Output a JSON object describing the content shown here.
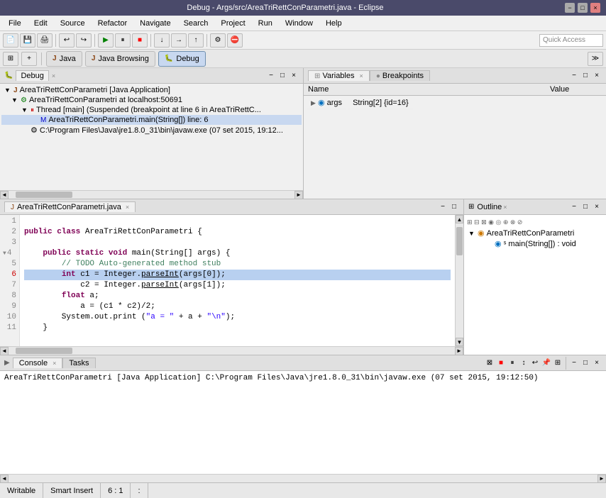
{
  "titleBar": {
    "text": "Debug - Args/src/AreaTriRettConParametri.java - Eclipse",
    "controls": [
      "−",
      "□",
      "×"
    ]
  },
  "menuBar": {
    "items": [
      "File",
      "Edit",
      "Source",
      "Refactor",
      "Navigate",
      "Search",
      "Project",
      "Run",
      "Window",
      "Help"
    ]
  },
  "toolbar2": {
    "perspectives": [
      "Java",
      "Java Browsing",
      "Debug"
    ],
    "quickAccess": "Quick Access"
  },
  "debugPanel": {
    "title": "Debug",
    "closeLabel": "×",
    "treeItems": [
      {
        "indent": 0,
        "label": "AreaTriRettConParametri [Java Application]",
        "icon": "J"
      },
      {
        "indent": 1,
        "label": "AreaTriRettConParametri at localhost:50691",
        "icon": "C"
      },
      {
        "indent": 2,
        "label": "Thread [main] (Suspended (breakpoint at line 6 in AreaTriRettC...",
        "icon": "T"
      },
      {
        "indent": 3,
        "label": "AreaTriRettConParametri.main(String[]) line: 6",
        "icon": "M"
      },
      {
        "indent": 2,
        "label": "C:\\Program Files\\Java\\jre1.8.0_31\\bin\\javaw.exe (07 set 2015, 19:12...",
        "icon": "C"
      }
    ]
  },
  "variablesPanel": {
    "tabs": [
      "Variables",
      "Breakpoints"
    ],
    "activeTab": "Variables",
    "columns": [
      "Name",
      "Value"
    ],
    "rows": [
      {
        "name": "args",
        "value": "String[2]  {id=16}",
        "arrow": true
      }
    ]
  },
  "editorPanel": {
    "filename": "AreaTriRettConParametri.java",
    "lines": [
      {
        "num": 1,
        "code": "",
        "type": "normal"
      },
      {
        "num": 2,
        "code": "public class AreaTriRettConParametri {",
        "type": "normal"
      },
      {
        "num": 3,
        "code": "",
        "type": "normal"
      },
      {
        "num": 4,
        "code": "    public static void main(String[] args) {",
        "type": "normal"
      },
      {
        "num": 5,
        "code": "        // TODO Auto-generated method stub",
        "type": "comment"
      },
      {
        "num": 6,
        "code": "        int c1 = Integer.parseInt(args[0]);",
        "type": "highlighted"
      },
      {
        "num": 7,
        "code": "            c2 = Integer.parseInt(args[1]);",
        "type": "normal"
      },
      {
        "num": 8,
        "code": "        float a;",
        "type": "normal"
      },
      {
        "num": 9,
        "code": "            a = (c1 * c2)/2;",
        "type": "normal"
      },
      {
        "num": 10,
        "code": "        System.out.print (\"a = \" + a + \"\\n\");",
        "type": "normal"
      },
      {
        "num": 11,
        "code": "    }",
        "type": "normal"
      }
    ]
  },
  "outlinePanel": {
    "title": "Outline",
    "items": [
      {
        "label": "AreaTriRettConParametri",
        "icon": "C",
        "indent": 0
      },
      {
        "label": "main(String[]) : void",
        "icon": "M",
        "indent": 1
      }
    ]
  },
  "consolePanel": {
    "title": "Console",
    "tabs": [
      "Console",
      "Tasks"
    ],
    "activeTab": "Console",
    "content": "AreaTriRettConParametri [Java Application] C:\\Program Files\\Java\\jre1.8.0_31\\bin\\javaw.exe (07 set 2015, 19:12:50)"
  },
  "statusBar": {
    "writable": "Writable",
    "insertMode": "Smart Insert",
    "position": "6 : 1",
    "separator": ":"
  }
}
